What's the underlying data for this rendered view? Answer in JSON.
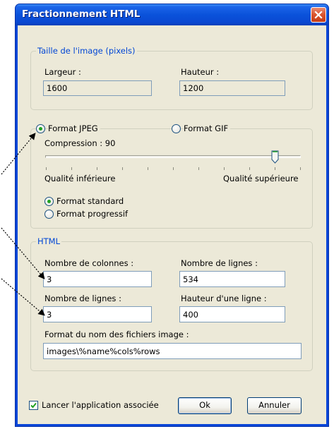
{
  "window": {
    "title": "Fractionnement HTML"
  },
  "image_size": {
    "legend": "Taille de l'image (pixels)",
    "width_label": "Largeur :",
    "width_value": "1600",
    "height_label": "Hauteur :",
    "height_value": "1200"
  },
  "format": {
    "jpeg_label": "Format JPEG",
    "jpeg_checked": true,
    "gif_label": "Format GIF",
    "gif_checked": false,
    "compression_label": "Compression : 90",
    "compression_value": 90,
    "quality_low_label": "Qualité inférieure",
    "quality_high_label": "Qualité supérieure",
    "standard_label": "Format standard",
    "standard_checked": true,
    "progressive_label": "Format progressif",
    "progressive_checked": false
  },
  "html": {
    "legend": "HTML",
    "columns_label": "Nombre de colonnes :",
    "columns_value": "3",
    "rows_label_right": "Nombre de lignes :",
    "rows_value_right": "534",
    "rows_label": "Nombre de lignes :",
    "rows_value": "3",
    "row_height_label": "Hauteur d'une ligne :",
    "row_height_value": "400",
    "filename_label": "Format du nom des fichiers image :",
    "filename_value": "images\\%name%cols%rows"
  },
  "footer": {
    "launch_label": "Lancer l'application associée",
    "launch_checked": true,
    "ok_label": "Ok",
    "cancel_label": "Annuler"
  },
  "colors": {
    "title_bar": "#0a52da",
    "close_button": "#d9542d",
    "group_legend": "#0046d5",
    "radio_dot": "#21a121",
    "dialog_bg": "#ece9d8"
  },
  "icons": {
    "close": "close-icon",
    "slider_thumb": "slider-thumb-icon",
    "checkmark": "checkmark-icon"
  }
}
